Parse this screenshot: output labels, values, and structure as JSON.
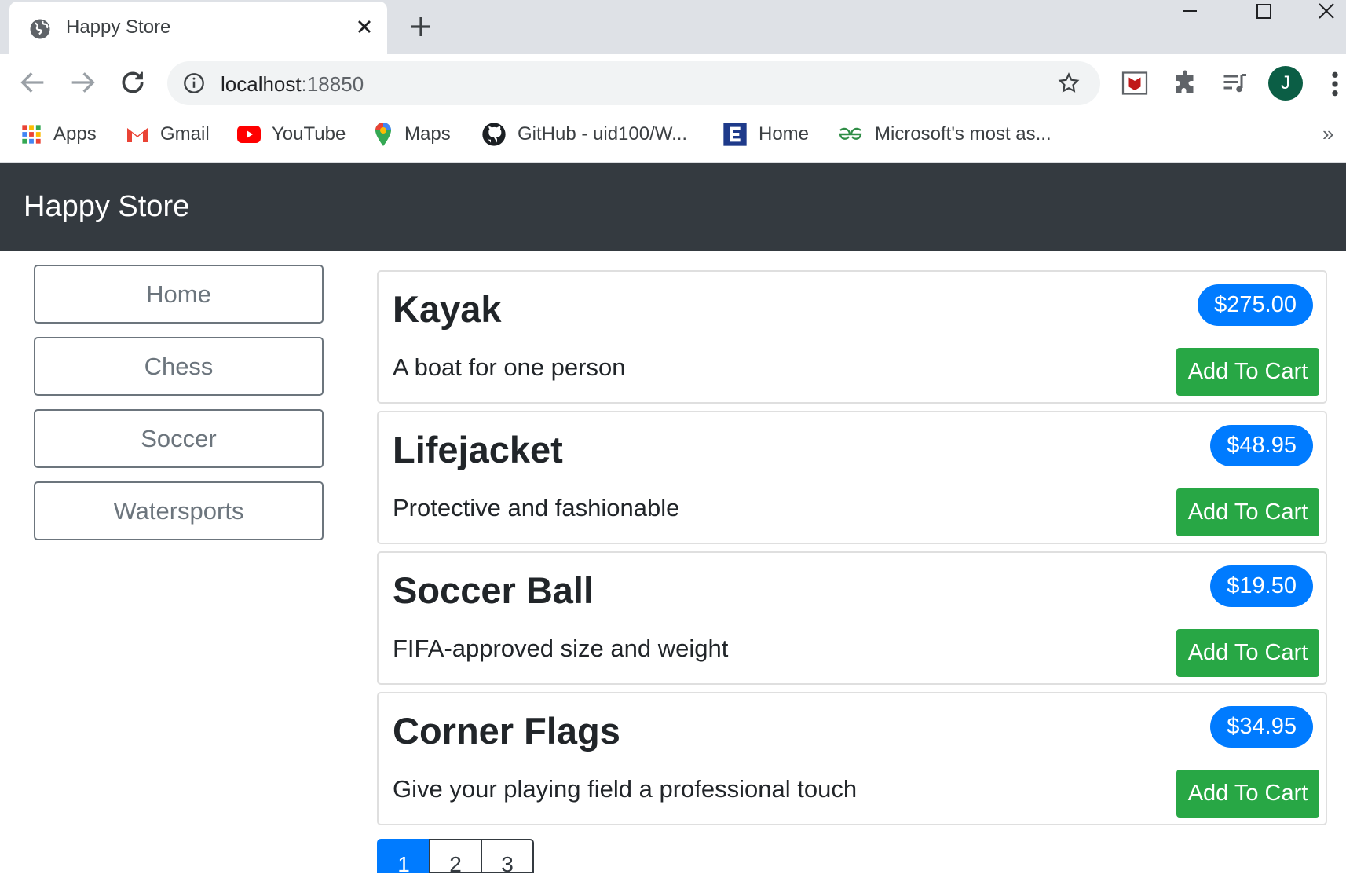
{
  "browser": {
    "tab_title": "Happy Store",
    "url_host": "localhost",
    "url_port": ":18850",
    "avatar_initial": "J",
    "bookmarks": [
      "Apps",
      "Gmail",
      "YouTube",
      "Maps",
      "GitHub - uid100/W...",
      "Home",
      "Microsoft's most as..."
    ],
    "bookmarks_more": "»"
  },
  "store": {
    "brand": "Happy Store",
    "categories": [
      "Home",
      "Chess",
      "Soccer",
      "Watersports"
    ],
    "products": [
      {
        "name": "Kayak",
        "description": "A boat for one person",
        "price": "$275.00",
        "button": "Add To Cart"
      },
      {
        "name": "Lifejacket",
        "description": "Protective and fashionable",
        "price": "$48.95",
        "button": "Add To Cart"
      },
      {
        "name": "Soccer Ball",
        "description": "FIFA-approved size and weight",
        "price": "$19.50",
        "button": "Add To Cart"
      },
      {
        "name": "Corner Flags",
        "description": "Give your playing field a professional touch",
        "price": "$34.95",
        "button": "Add To Cart"
      }
    ],
    "pages": [
      "1",
      "2",
      "3"
    ],
    "active_page": "1"
  },
  "colors": {
    "navbar": "#343a40",
    "price_badge": "#007bff",
    "add_button": "#28a745",
    "category_border": "#6c757d"
  }
}
